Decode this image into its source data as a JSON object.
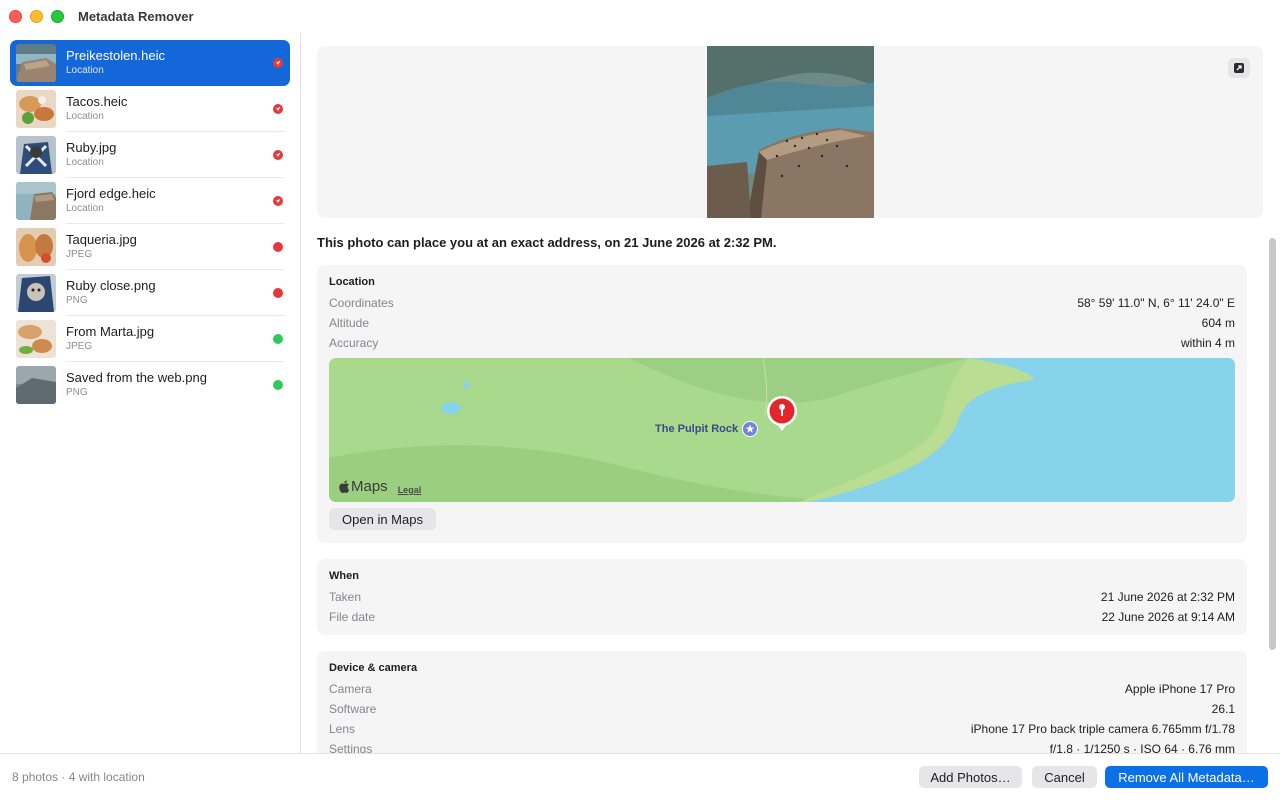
{
  "window": {
    "title": "Metadata Remover"
  },
  "files": [
    {
      "name": "Preikestolen.heic",
      "detail": "Location",
      "status": "location",
      "selected": true
    },
    {
      "name": "Tacos.heic",
      "detail": "Location",
      "status": "location"
    },
    {
      "name": "Ruby.jpg",
      "detail": "Location",
      "status": "location"
    },
    {
      "name": "Fjord edge.heic",
      "detail": "Location",
      "status": "location"
    },
    {
      "name": "Taqueria.jpg",
      "detail": "JPEG",
      "status": "red"
    },
    {
      "name": "Ruby close.png",
      "detail": "PNG",
      "status": "red"
    },
    {
      "name": "From Marta.jpg",
      "detail": "JPEG",
      "status": "green"
    },
    {
      "name": "Saved from the web.png",
      "detail": "PNG",
      "status": "green"
    }
  ],
  "colors": {
    "status_red": "#e5383b",
    "status_green": "#34c759",
    "accent": "#1367d9"
  },
  "detail": {
    "warning": "This photo can place you at an exact address, on 21 June 2026 at 2:32 PM.",
    "location": {
      "title": "Location",
      "rows": [
        {
          "label": "Coordinates",
          "value": "58° 59' 11.0\" N, 6° 11' 24.0\" E"
        },
        {
          "label": "Altitude",
          "value": "604 m"
        },
        {
          "label": "Accuracy",
          "value": "within 4 m"
        }
      ],
      "map": {
        "place_label": "The Pulpit Rock",
        "brand": "Maps",
        "legal": "Legal"
      },
      "open_button": "Open in Maps"
    },
    "when": {
      "title": "When",
      "rows": [
        {
          "label": "Taken",
          "value": "21 June 2026 at 2:32 PM"
        },
        {
          "label": "File date",
          "value": "22 June 2026 at 9:14 AM"
        }
      ]
    },
    "device": {
      "title": "Device & camera",
      "rows": [
        {
          "label": "Camera",
          "value": "Apple iPhone 17 Pro"
        },
        {
          "label": "Software",
          "value": "26.1"
        },
        {
          "label": "Lens",
          "value": "iPhone 17 Pro back triple camera 6.765mm f/1.78"
        },
        {
          "label": "Settings",
          "value": "f/1.8 · 1/1250 s · ISO 64 · 6.76 mm"
        }
      ]
    }
  },
  "footer": {
    "status": "8 photos · 4 with location",
    "add_button": "Add Photos…",
    "cancel_button": "Cancel",
    "remove_button": "Remove All Metadata…"
  }
}
